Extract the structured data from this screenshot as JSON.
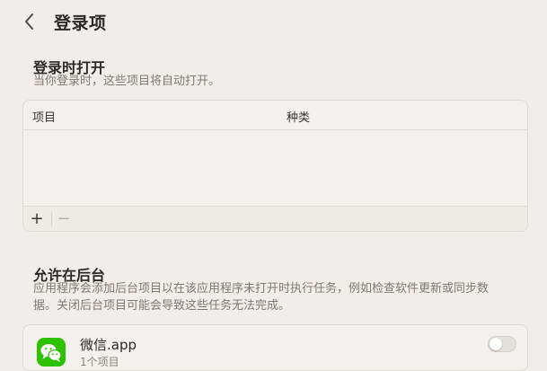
{
  "header": {
    "back_icon": "chevron-left-icon",
    "title": "登录项"
  },
  "login_open": {
    "title": "登录时打开",
    "description": "当你登录时，这些项目将自动打开。",
    "table": {
      "columns": [
        "项目",
        "种类"
      ],
      "rows": []
    },
    "footer": {
      "add_label": "+",
      "remove_label": "−"
    }
  },
  "background": {
    "title": "允许在后台",
    "description_line1": "应用程序会添加后台项目以在该应用程序未打开时执行任务，例如检查软件更新或同步数",
    "description_line2": "据。关闭后台项目可能会导致这些任务无法完成。",
    "items": [
      {
        "name": "微信.app",
        "subtitle": "1个项目",
        "icon": "wechat-icon",
        "enabled": false
      }
    ]
  },
  "colors": {
    "background": "#f1edea",
    "wechat_green": "#2dc100"
  }
}
